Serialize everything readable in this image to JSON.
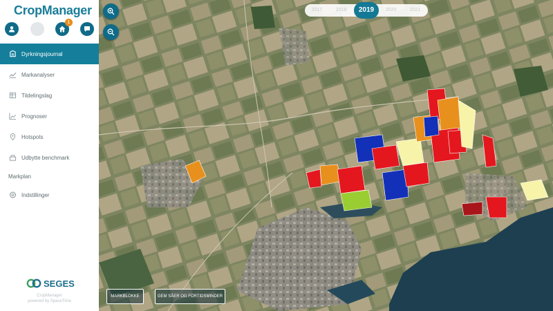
{
  "app": {
    "title": "CropManager",
    "notification_count": "1"
  },
  "top_icons": [
    "user-icon",
    "placeholder-icon",
    "home-icon",
    "chat-icon"
  ],
  "nav": [
    {
      "label": "Dyrkningsjournal",
      "icon": "journal-icon",
      "active": true
    },
    {
      "label": "Markanalyser",
      "icon": "analysis-icon",
      "active": false
    },
    {
      "label": "Tildelingslag",
      "icon": "layers-icon",
      "active": false
    },
    {
      "label": "Prognoser",
      "icon": "chart-icon",
      "active": false
    },
    {
      "label": "Hotspots",
      "icon": "pin-icon",
      "active": false
    },
    {
      "label": "Udbytte benchmark",
      "icon": "benchmark-icon",
      "active": false
    }
  ],
  "section": {
    "label": "Markplan"
  },
  "nav_bottom": [
    {
      "label": "Indstillinger",
      "icon": "settings-icon"
    }
  ],
  "brand": {
    "name": "SEGES"
  },
  "footer": {
    "line1": "CropManager",
    "line2": "powered by SpaceTime"
  },
  "map": {
    "years": [
      "2017",
      "2018",
      "2019",
      "2020",
      "2021"
    ],
    "selected_year": "2019",
    "buttons": {
      "markblokke": "MARKBLOKKE",
      "gem": "GEM SÅER OG FORTIDSMINDER"
    }
  },
  "colors": {
    "accent": "#147994",
    "field_red": "#e4171e",
    "field_blue": "#1230b8",
    "field_orange": "#e8901e",
    "field_yellow": "#f7f3a8"
  }
}
